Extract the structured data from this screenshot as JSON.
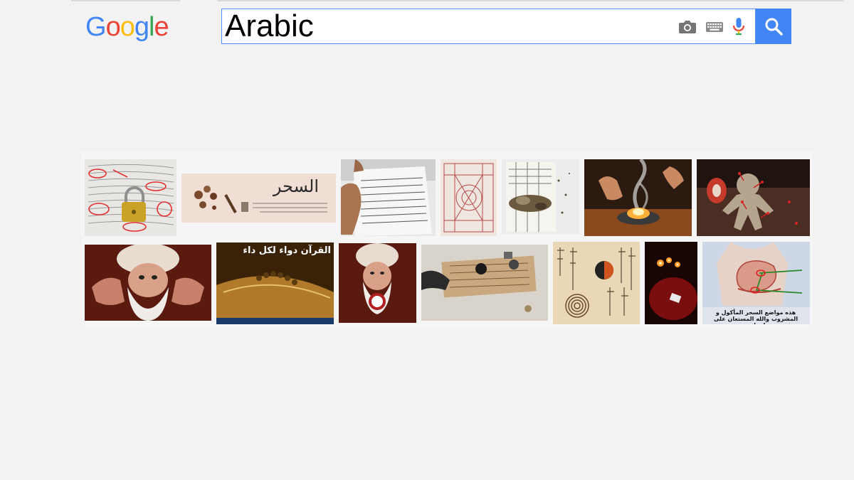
{
  "logo": {
    "letters": [
      "G",
      "o",
      "o",
      "g",
      "l",
      "e"
    ],
    "colors": [
      "#4285f4",
      "#ea4335",
      "#fbbc05",
      "#4285f4",
      "#34a853",
      "#ea4335"
    ]
  },
  "search": {
    "query": "Arabic",
    "placeholder": ""
  },
  "icons": {
    "camera": "camera-icon",
    "keyboard": "keyboard-icon",
    "mic": "microphone-icon",
    "search": "search-icon"
  },
  "colors": {
    "accent": "#4285f4",
    "background": "#f2f2f2"
  },
  "images": {
    "row1": [
      {
        "id": "padlock-manuscript",
        "text": ""
      },
      {
        "id": "sihr-banner",
        "text": "السحر"
      },
      {
        "id": "hand-holding-paper",
        "text": ""
      },
      {
        "id": "talisman-grid",
        "text": ""
      },
      {
        "id": "paper-with-debris",
        "text": ""
      },
      {
        "id": "smoke-bowl",
        "text": ""
      },
      {
        "id": "voodoo-doll",
        "text": ""
      }
    ],
    "row2": [
      {
        "id": "old-man-orb",
        "text": ""
      },
      {
        "id": "quran-tasbih",
        "text": "القرآن دواء لكل داء"
      },
      {
        "id": "old-man-orb-2",
        "text": ""
      },
      {
        "id": "talisman-objects",
        "text": ""
      },
      {
        "id": "chinese-script-spiral",
        "text": ""
      },
      {
        "id": "candles-red",
        "text": ""
      },
      {
        "id": "body-diagram",
        "text": "هذه مواضع السحر المأكول و المشروب والله المستعان على إخراجه"
      }
    ]
  }
}
